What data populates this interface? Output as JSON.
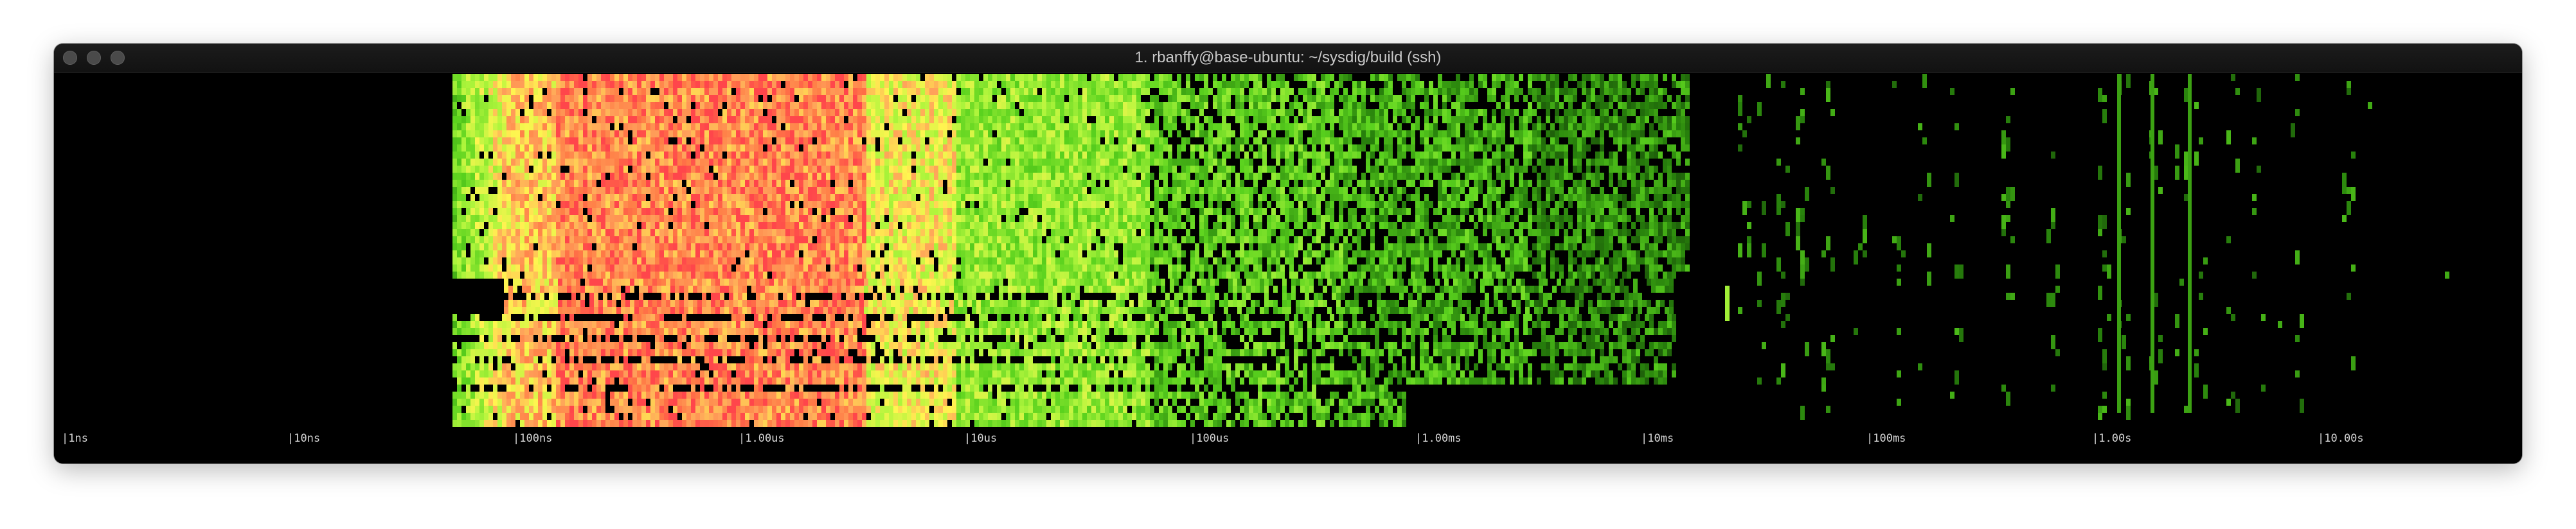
{
  "window": {
    "title": "1. rbanffy@base-ubuntu: ~/sysdig/build (ssh)",
    "traffic_lights": [
      "close",
      "minimize",
      "zoom"
    ]
  },
  "colors": {
    "background": "#000000",
    "titlebar": "#161616",
    "title_text": "#c8c8c8",
    "axis_text": "#d6d6d6",
    "heat_low": "#1a5a0a",
    "heat_mid": "#7dea2a",
    "heat_high": "#fff24a",
    "heat_peak": "#ff4a4a"
  },
  "axis": {
    "ticks": [
      {
        "label": "|1ns"
      },
      {
        "label": "|10ns"
      },
      {
        "label": "|100ns"
      },
      {
        "label": "|1.00us"
      },
      {
        "label": "|10us"
      },
      {
        "label": "|100us"
      },
      {
        "label": "|1.00ms"
      },
      {
        "label": "|10ms"
      },
      {
        "label": "|100ms"
      },
      {
        "label": "|1.00s"
      },
      {
        "label": "|10.00s"
      }
    ]
  }
}
